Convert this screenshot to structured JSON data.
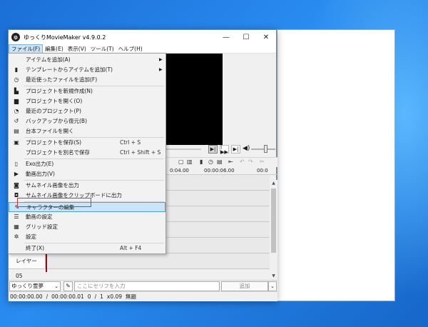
{
  "window": {
    "title": "ゆっくりMovieMaker v4.9.0.2",
    "icon_text": "ゆ"
  },
  "caption": {
    "minimize": "—",
    "maximize": "☐",
    "close": "✕"
  },
  "menubar": {
    "items": [
      {
        "label": "ファイル(F)"
      },
      {
        "label": "編集(E)"
      },
      {
        "label": "表示(V)"
      },
      {
        "label": "ツール(T)"
      },
      {
        "label": "ヘルプ(H)"
      }
    ]
  },
  "file_menu": {
    "items": [
      {
        "icon": "",
        "label": "アイテムを追加(A)",
        "shortcut": "",
        "submenu": "▶"
      },
      {
        "icon": "▮",
        "label": "テンプレートからアイテムを追加(T)",
        "shortcut": "",
        "submenu": "▶"
      },
      {
        "icon": "◷",
        "label": "最近使ったファイルを追加(F)",
        "shortcut": "",
        "submenu": ""
      },
      {
        "icon": "▙",
        "label": "プロジェクトを新規作成(N)",
        "shortcut": "",
        "submenu": ""
      },
      {
        "icon": "▆",
        "label": "プロジェクトを開く(O)",
        "shortcut": "",
        "submenu": ""
      },
      {
        "icon": "◔",
        "label": "最近のプロジェクト(P)",
        "shortcut": "",
        "submenu": ""
      },
      {
        "icon": "↺",
        "label": "バックアップから復元(B)",
        "shortcut": "",
        "submenu": ""
      },
      {
        "icon": "▤",
        "label": "台本ファイルを開く",
        "shortcut": "",
        "submenu": ""
      },
      {
        "icon": "▣",
        "label": "プロジェクトを保存(S)",
        "shortcut": "Ctrl + S",
        "submenu": ""
      },
      {
        "icon": "",
        "label": "プロジェクトを別名で保存",
        "shortcut": "Ctrl + Shift + S",
        "submenu": ""
      },
      {
        "icon": "▯",
        "label": "Exo出力(E)",
        "shortcut": "",
        "submenu": ""
      },
      {
        "icon": "▶",
        "label": "動画出力(V)",
        "shortcut": "",
        "submenu": ""
      },
      {
        "icon": "◙",
        "label": "サムネイル画像を出力",
        "shortcut": "",
        "submenu": ""
      },
      {
        "icon": "◘",
        "label": "サムネイル画像をクリップボードに出力",
        "shortcut": "",
        "submenu": ""
      },
      {
        "icon": "✎",
        "label": "キャラクターの編集",
        "shortcut": "",
        "submenu": ""
      },
      {
        "icon": "☰",
        "label": "動画の設定",
        "shortcut": "",
        "submenu": ""
      },
      {
        "icon": "▦",
        "label": "グリッド設定",
        "shortcut": "",
        "submenu": ""
      },
      {
        "icon": "✲",
        "label": "設定",
        "shortcut": "",
        "submenu": ""
      },
      {
        "icon": "",
        "label": "終了(X)",
        "shortcut": "Alt + F4",
        "submenu": ""
      }
    ]
  },
  "transport": {
    "play": "▶|",
    "step": "|▶▶",
    "end": "▶|",
    "volume_icon": "◀)"
  },
  "volume_level": 0.6,
  "timeline_toolbar": {
    "icons": [
      "▢",
      "▥",
      "▮",
      "◷",
      "▤",
      "⇤",
      "↶",
      "↷",
      "✂"
    ]
  },
  "ruler": {
    "t1": "0:04.00",
    "t2": "00:00:06.00",
    "t3": "00:0"
  },
  "lanes": [
    {
      "label": ""
    },
    {
      "label": ""
    },
    {
      "label": ""
    },
    {
      "label": ""
    },
    {
      "label": ""
    },
    {
      "label": "レイヤー 05"
    }
  ],
  "bottom": {
    "character": "ゆっくり霊夢",
    "dropdown": "⌄",
    "char_button": "✎",
    "input_placeholder": "ここにセリフを入力",
    "add_label": "追加",
    "add_dropdown": "⌄"
  },
  "status": {
    "position": "00:00:00.00",
    "slash": "/",
    "duration": "00:00:00.01",
    "frame": "0",
    "frame_sep": "/",
    "frame_total": "1",
    "zoom": "x0.09",
    "title": "無題"
  },
  "colors": {
    "highlight": "#cce4f7",
    "highlight_border": "#4aa0e6",
    "annotation": "#d9342c",
    "playhead": "#8b1010"
  }
}
